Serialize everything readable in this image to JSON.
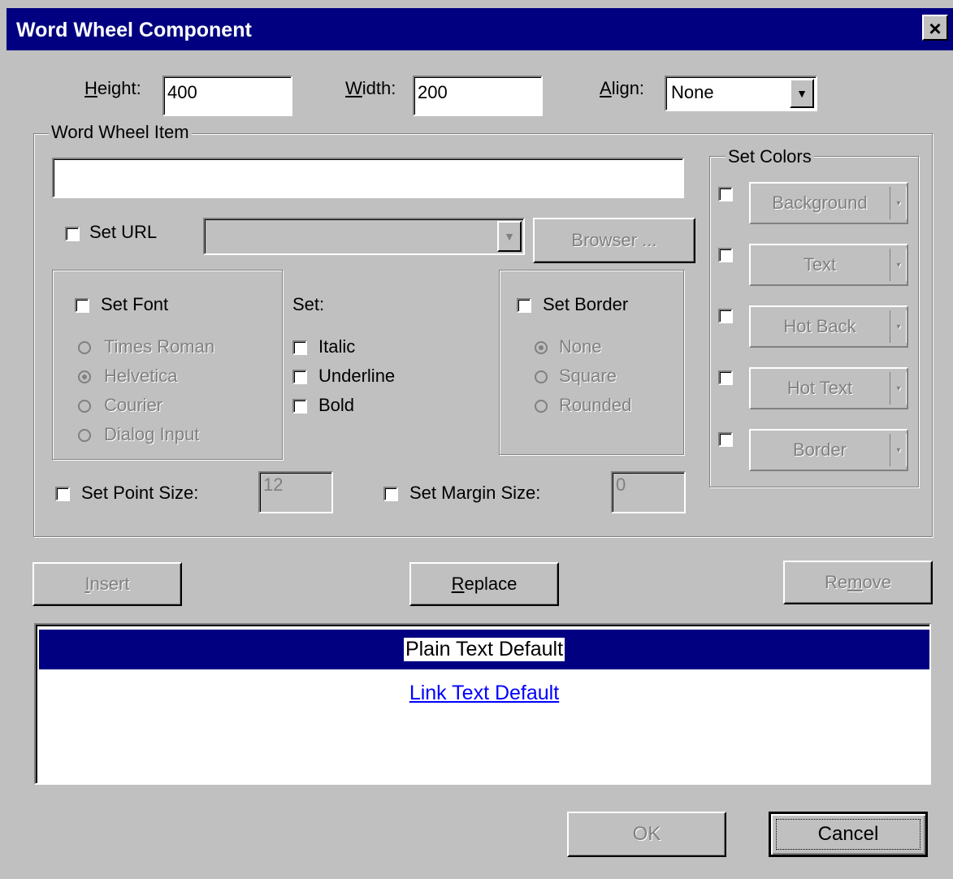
{
  "window": {
    "title": "Word Wheel Component",
    "close_glyph": "×"
  },
  "dimensions": {
    "height_label_u": "H",
    "height_label_rest": "eight:",
    "height_value": "400",
    "width_label_u": "W",
    "width_label_rest": "idth:",
    "width_value": "200",
    "align_label_u": "A",
    "align_label_rest": "lign:",
    "align_value": "None"
  },
  "item_group": {
    "title": "Word Wheel Item",
    "item_text": "",
    "set_url_label": "Set URL",
    "url_value": "",
    "browser_button": "Browser ...",
    "set_font_label": "Set Font",
    "fonts": [
      {
        "label": "Times Roman",
        "selected": false
      },
      {
        "label": "Helvetica",
        "selected": true
      },
      {
        "label": "Courier",
        "selected": false
      },
      {
        "label": "Dialog Input",
        "selected": false
      }
    ],
    "set_label": "Set:",
    "styles": [
      "Italic",
      "Underline",
      "Bold"
    ],
    "set_border_label": "Set Border",
    "borders": [
      {
        "label": "None",
        "selected": true
      },
      {
        "label": "Square",
        "selected": false
      },
      {
        "label": "Rounded",
        "selected": false
      }
    ],
    "point_size_label": "Set Point Size:",
    "point_size_value": "12",
    "margin_size_label": "Set Margin Size:",
    "margin_size_value": "0"
  },
  "colors_group": {
    "title": "Set Colors",
    "buttons": [
      "Background",
      "Text",
      "Hot Back",
      "Hot Text",
      "Border"
    ]
  },
  "actions": {
    "insert_u": "I",
    "insert_rest": "nsert",
    "replace_u": "R",
    "replace_rest": "eplace",
    "remove_pre": "Re",
    "remove_u": "m",
    "remove_rest": "ove"
  },
  "list": {
    "items": [
      {
        "text": "Plain Text Default",
        "selected": true
      },
      {
        "text": "Link Text Default",
        "selected": false
      }
    ]
  },
  "footer": {
    "ok": "OK",
    "cancel": "Cancel"
  },
  "colors": {
    "titlebar": "#000080",
    "face": "#c0c0c0",
    "link": "#0000ff"
  }
}
